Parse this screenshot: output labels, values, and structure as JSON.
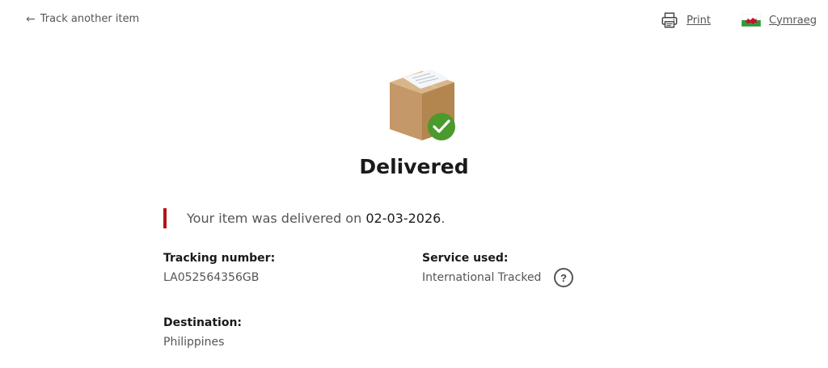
{
  "header": {
    "back_label": "Track another item",
    "print_label": "Print",
    "language_label": "Cymraeg"
  },
  "status": {
    "title": "Delivered",
    "message_prefix": "Your item was delivered on ",
    "delivered_date": "02-03-2026",
    "message_suffix": "."
  },
  "details": {
    "tracking_label": "Tracking number:",
    "tracking_value": "LA052564356GB",
    "service_label": "Service used:",
    "service_value": "International Tracked",
    "help_label": "?",
    "destination_label": "Destination:",
    "destination_value": "Philippines"
  },
  "icons": {
    "back": "arrow-left-icon",
    "print": "printer-icon",
    "language": "welsh-flag-icon",
    "status": "parcel-delivered-icon",
    "help": "question-mark-icon"
  },
  "colors": {
    "accent_red": "#b3141b",
    "success_green": "#4a9a2c",
    "text_dark": "#1a1a1a",
    "text_muted": "#555555"
  }
}
